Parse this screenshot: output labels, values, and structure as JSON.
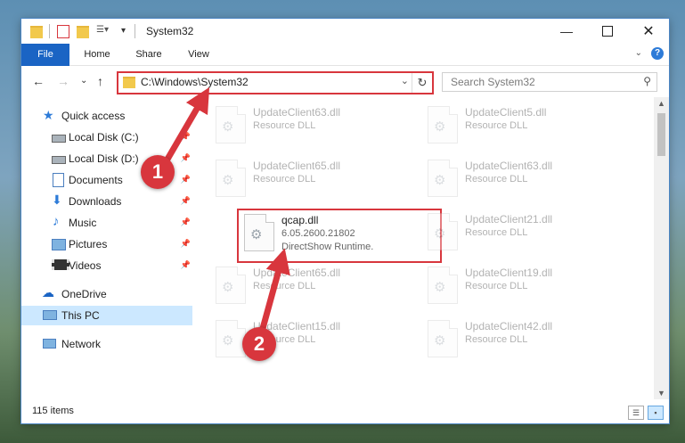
{
  "window": {
    "title": "System32"
  },
  "ribbon": {
    "tabs": [
      "File",
      "Home",
      "Share",
      "View"
    ]
  },
  "address": {
    "path": "C:\\Windows\\System32"
  },
  "search": {
    "placeholder": "Search System32"
  },
  "sidebar": {
    "items": [
      {
        "label": "Quick access",
        "icon": "star-icon",
        "pinned": false
      },
      {
        "label": "Local Disk (C:)",
        "icon": "drive-icon",
        "pinned": true
      },
      {
        "label": "Local Disk (D:)",
        "icon": "drive-icon",
        "pinned": true
      },
      {
        "label": "Documents",
        "icon": "documents-icon",
        "pinned": true
      },
      {
        "label": "Downloads",
        "icon": "download-icon",
        "pinned": true
      },
      {
        "label": "Music",
        "icon": "music-icon",
        "pinned": true
      },
      {
        "label": "Pictures",
        "icon": "pictures-icon",
        "pinned": true
      },
      {
        "label": "Videos",
        "icon": "videos-icon",
        "pinned": true
      },
      {
        "label": "OneDrive",
        "icon": "cloud-icon",
        "pinned": false
      },
      {
        "label": "This PC",
        "icon": "computer-icon",
        "pinned": false,
        "selected": true
      },
      {
        "label": "Network",
        "icon": "network-icon",
        "pinned": false
      }
    ]
  },
  "files": [
    {
      "name": "UpdateClient63.dll",
      "desc": "Resource DLL"
    },
    {
      "name": "UpdateClient5.dll",
      "desc": "Resource DLL"
    },
    {
      "name": "UpdateClient65.dll",
      "desc": "Resource DLL"
    },
    {
      "name": "UpdateClient63.dll",
      "desc": "Resource DLL"
    },
    {
      "name": "qcap.dll",
      "desc": "6.05.2600.21802",
      "desc2": "DirectShow Runtime.",
      "highlighted": true
    },
    {
      "name": "UpdateClient21.dll",
      "desc": "Resource DLL"
    },
    {
      "name": "UpdateClient65.dll",
      "desc": "Resource DLL"
    },
    {
      "name": "UpdateClient19.dll",
      "desc": "Resource DLL"
    },
    {
      "name": "UpdateClient15.dll",
      "desc": "Resource DLL"
    },
    {
      "name": "UpdateClient42.dll",
      "desc": "Resource DLL"
    }
  ],
  "status": {
    "item_count": "115 items"
  },
  "annotations": {
    "step1": "1",
    "step2": "2",
    "color": "#d8363d"
  }
}
